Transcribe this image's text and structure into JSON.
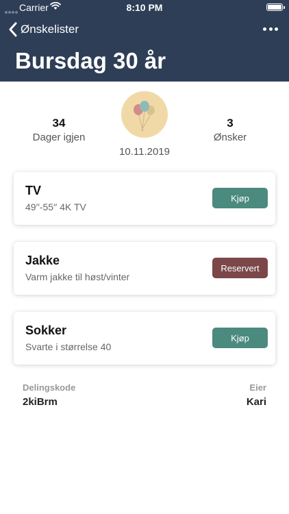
{
  "status_bar": {
    "carrier": "Carrier",
    "time": "8:10 PM"
  },
  "nav": {
    "back_label": "Ønskelister"
  },
  "page": {
    "title": "Bursdag 30 år"
  },
  "stats": {
    "days_value": "34",
    "days_label": "Dager igjen",
    "date": "10.11.2019",
    "wishes_value": "3",
    "wishes_label": "Ønsker"
  },
  "wishes": [
    {
      "title": "TV",
      "description": "49′′-55′′ 4K TV",
      "action": "Kjøp",
      "status": "buy"
    },
    {
      "title": "Jakke",
      "description": "Varm jakke til høst/vinter",
      "action": "Reservert",
      "status": "reserved"
    },
    {
      "title": "Sokker",
      "description": "Svarte i størrelse 40",
      "action": "Kjøp",
      "status": "buy"
    }
  ],
  "footer": {
    "share_code_label": "Delingskode",
    "share_code": "2kiBrm",
    "owner_label": "Eier",
    "owner": "Kari"
  },
  "colors": {
    "header": "#2e3e56",
    "buy_button": "#4b8a7e",
    "reserved_button": "#7b4748",
    "avatar_bg": "#f1d9a7"
  },
  "icons": {
    "back": "chevron-left-icon",
    "more": "more-dots-icon",
    "avatar": "balloons-icon"
  }
}
